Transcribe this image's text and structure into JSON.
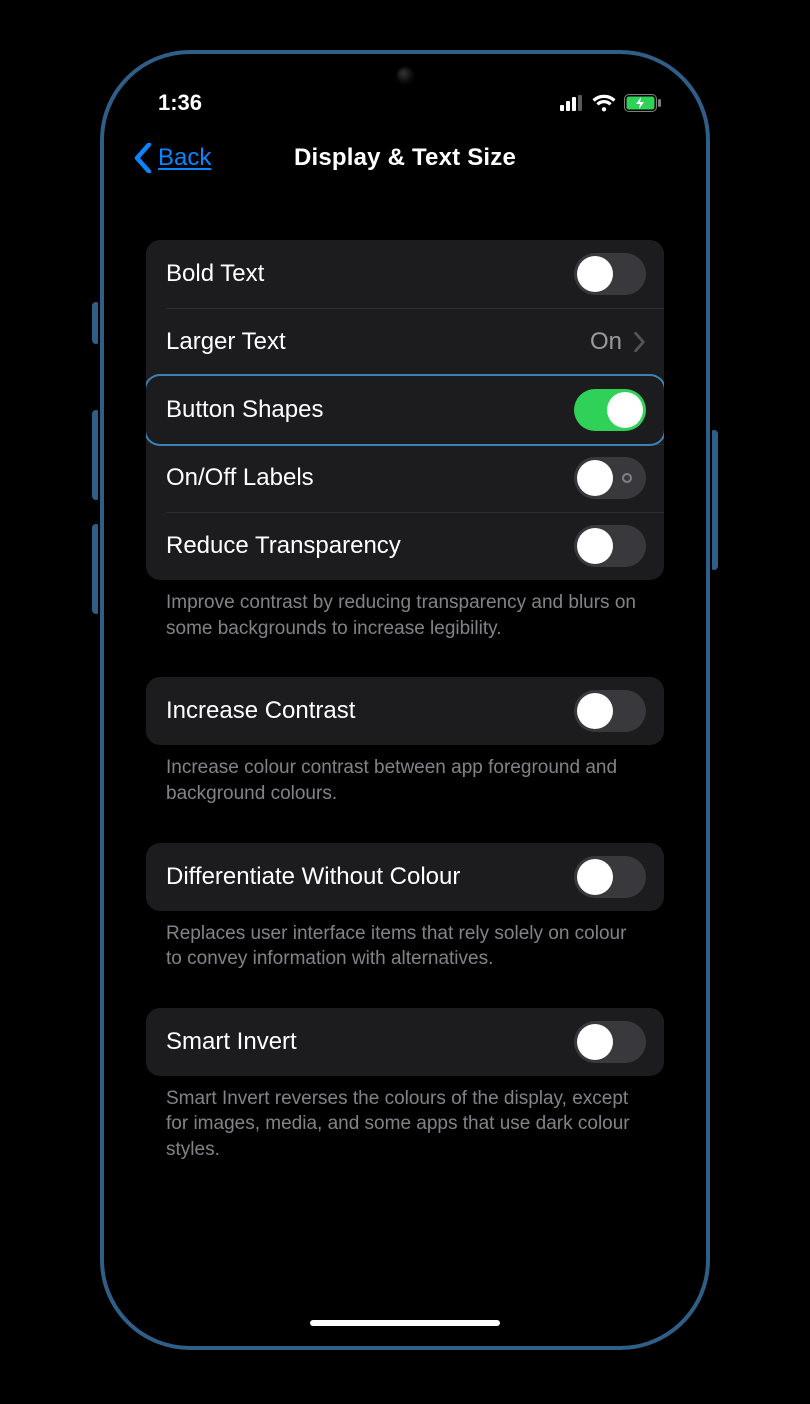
{
  "status": {
    "time": "1:36"
  },
  "nav": {
    "back": "Back",
    "title": "Display & Text Size"
  },
  "colors": {
    "accent": "#0a84ff",
    "toggle_on": "#30d158"
  },
  "groups": [
    {
      "footer": "Improve contrast by reducing transparency and blurs on some backgrounds to increase legibility.",
      "items": [
        {
          "id": "boldText",
          "label": "Bold Text",
          "type": "toggle",
          "on": false
        },
        {
          "id": "largerText",
          "label": "Larger Text",
          "type": "nav",
          "value": "On"
        },
        {
          "id": "buttonShapes",
          "label": "Button Shapes",
          "type": "toggle",
          "on": true,
          "focused": true
        },
        {
          "id": "onOffLabels",
          "label": "On/Off Labels",
          "type": "toggle",
          "on": false,
          "showMarker": true
        },
        {
          "id": "reduceTransparency",
          "label": "Reduce Transparency",
          "type": "toggle",
          "on": false
        }
      ]
    },
    {
      "footer": "Increase colour contrast between app foreground and background colours.",
      "items": [
        {
          "id": "increaseContrast",
          "label": "Increase Contrast",
          "type": "toggle",
          "on": false
        }
      ]
    },
    {
      "footer": "Replaces user interface items that rely solely on colour to convey information with alternatives.",
      "items": [
        {
          "id": "differentiateColour",
          "label": "Differentiate Without Colour",
          "type": "toggle",
          "on": false
        }
      ]
    },
    {
      "footer": "Smart Invert reverses the colours of the display, except for images, media, and some apps that use dark colour styles.",
      "items": [
        {
          "id": "smartInvert",
          "label": "Smart Invert",
          "type": "toggle",
          "on": false
        }
      ]
    }
  ]
}
